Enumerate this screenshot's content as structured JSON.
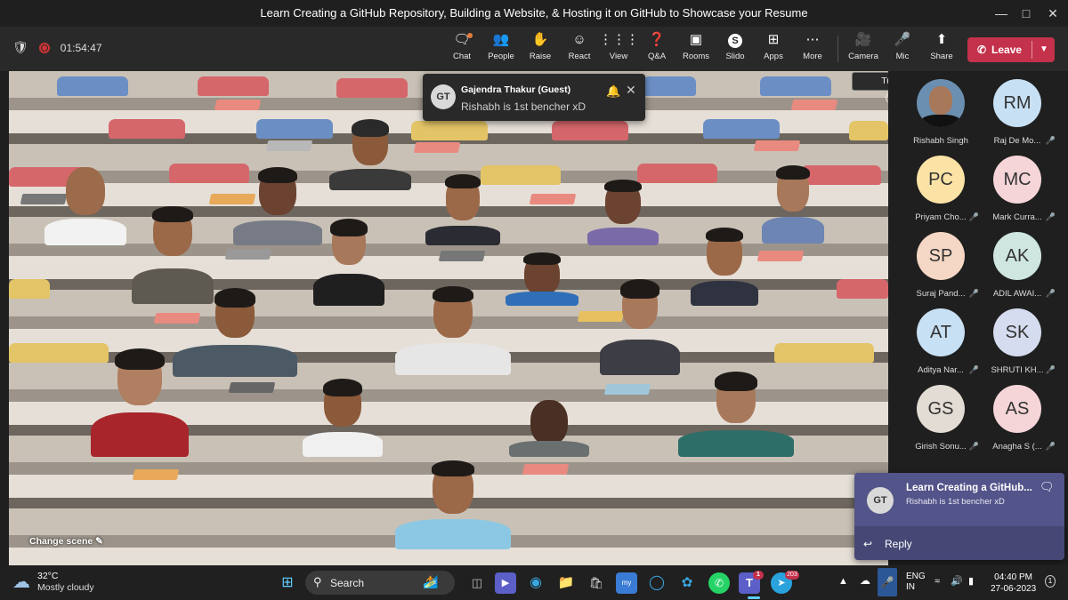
{
  "window": {
    "title": "Learn Creating a GitHub Repository, Building a Website, & Hosting it on GitHub to Showcase your Resume"
  },
  "meeting": {
    "elapsed": "01:54:47"
  },
  "toolbar": {
    "chat": "Chat",
    "people": "People",
    "raise": "Raise",
    "react": "React",
    "view": "View",
    "qa": "Q&A",
    "rooms": "Rooms",
    "slido": "Slido",
    "apps": "Apps",
    "more": "More",
    "camera": "Camera",
    "mic": "Mic",
    "share": "Share",
    "leave": "Leave"
  },
  "tooltip": "Turn camera off (Ctrl+Shift+O)",
  "toast": {
    "initials": "GT",
    "sender": "Gajendra Thakur (Guest)",
    "message": "Rishabh is 1st bencher xD"
  },
  "stage": {
    "change_scene": "Change scene"
  },
  "participants": [
    {
      "initials": "",
      "name": "Rishabh Singh",
      "color": "#6b8fb0",
      "mic_off": false
    },
    {
      "initials": "RM",
      "name": "Raj De Mo...",
      "color": "#c7e0f4",
      "mic_off": true
    },
    {
      "initials": "PC",
      "name": "Priyam Cho...",
      "color": "#fbe3a6",
      "mic_off": true
    },
    {
      "initials": "MC",
      "name": "Mark Curra...",
      "color": "#f5d5d8",
      "mic_off": true
    },
    {
      "initials": "SP",
      "name": "Suraj Pand...",
      "color": "#f4d7c4",
      "mic_off": true
    },
    {
      "initials": "AK",
      "name": "ADIL AWAI...",
      "color": "#cfe6e0",
      "mic_off": true
    },
    {
      "initials": "AT",
      "name": "Aditya Nar...",
      "color": "#c7e0f4",
      "mic_off": true
    },
    {
      "initials": "SK",
      "name": "SHRUTI KH...",
      "color": "#d6dcef",
      "mic_off": true
    },
    {
      "initials": "GS",
      "name": "Girish Sonu...",
      "color": "#e2dcd4",
      "mic_off": true
    },
    {
      "initials": "AS",
      "name": "Anagha S (...",
      "color": "#f5d5d8",
      "mic_off": true
    }
  ],
  "notification": {
    "initials": "GT",
    "title": "Learn Creating a GitHub...",
    "message": "Rishabh is 1st bencher xD",
    "reply": "Reply"
  },
  "taskbar": {
    "temperature": "32°C",
    "weather": "Mostly cloudy",
    "search": "Search",
    "teams_badge": "1",
    "telegram_badge": "203",
    "lang1": "ENG",
    "lang2": "IN",
    "time": "04:40 PM",
    "date": "27-06-2023"
  },
  "colors": {
    "leave": "#c4314b",
    "notification": "#464775",
    "seat_blue": "#6b8fc4",
    "seat_red": "#d5676b",
    "seat_yellow": "#e3c567"
  }
}
